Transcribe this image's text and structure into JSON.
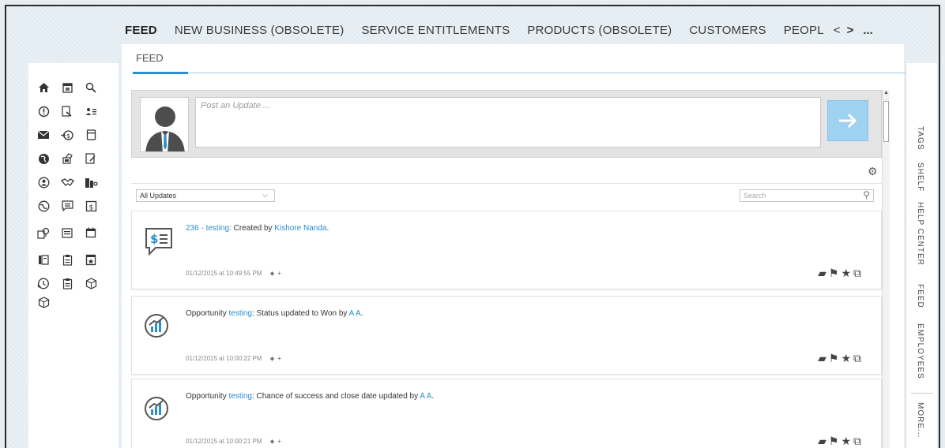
{
  "topnav": {
    "tabs": [
      {
        "label": "FEED",
        "active": true
      },
      {
        "label": "NEW BUSINESS (OBSOLETE)"
      },
      {
        "label": "SERVICE ENTITLEMENTS"
      },
      {
        "label": "PRODUCTS (OBSOLETE)"
      },
      {
        "label": "CUSTOMERS"
      },
      {
        "label": "PEOPL"
      }
    ],
    "prev": "<",
    "next": ">",
    "more": "..."
  },
  "leftnav": {
    "icons": [
      "home-icon",
      "calendar-icon",
      "search-icon",
      "alert-icon",
      "report-icon",
      "contacts-icon",
      "mail-icon",
      "payment-icon",
      "document-icon",
      "globe-icon",
      "phone-icon",
      "edit-icon",
      "user-circle-icon",
      "handshake-icon",
      "building-icon",
      "world-icon",
      "chat-icon",
      "invoice-icon",
      "map-pin-icon",
      "list-icon",
      "calendar-blank-icon",
      "books-icon",
      "clipboard-icon",
      "event-icon",
      "history-icon",
      "clipboard-check-icon",
      "box-icon",
      "cube-icon"
    ]
  },
  "subtab": {
    "label": "FEED"
  },
  "post": {
    "placeholder": "Post an Update ...",
    "submit_icon": "arrow-right-icon"
  },
  "filter": {
    "selected": "All Updates"
  },
  "search": {
    "placeholder": "Search"
  },
  "feed": [
    {
      "link1": "236 - testing:",
      "middle": " Created by ",
      "link2": "Kishore Nanda",
      "end": ".",
      "timestamp": "01/12/2015 at 10:49:55 PM",
      "icon": "invoice-chat-icon"
    },
    {
      "prefix": "Opportunity ",
      "link1": "testing",
      "middle": ": Status updated to Won by ",
      "link2": "A A",
      "end": ".",
      "timestamp": "01/12/2015 at 10:00:22 PM",
      "icon": "opportunity-icon"
    },
    {
      "prefix": "Opportunity ",
      "link1": "testing",
      "middle": ": Chance of success and close date updated by ",
      "link2": "A A",
      "end": ".",
      "timestamp": "01/12/2015 at 10:00:21 PM",
      "icon": "opportunity-icon"
    }
  ],
  "rightnav": {
    "tabs": [
      "TAGS",
      "SHELF",
      "HELP CENTER",
      "FEED",
      "EMPLOYEES",
      "MORE..."
    ]
  },
  "colors": {
    "accent": "#2a8fcb",
    "post_button": "#9fd1f0"
  }
}
